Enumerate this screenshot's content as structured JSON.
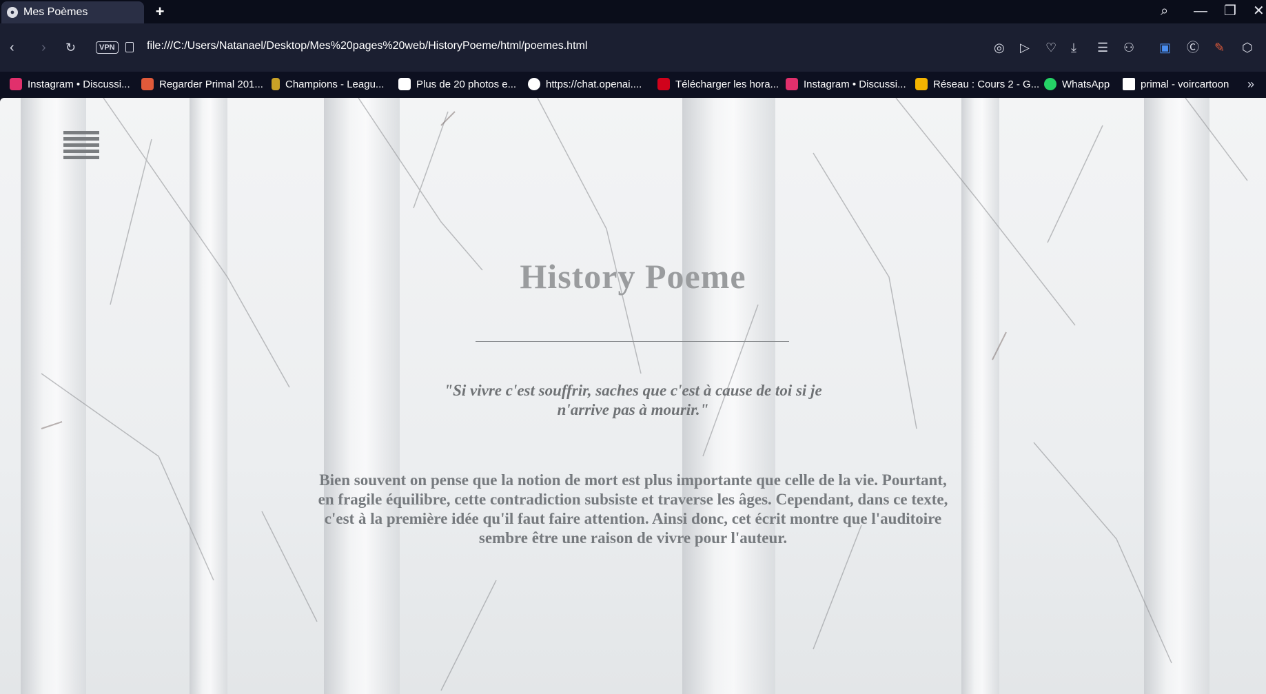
{
  "browser": {
    "tab": {
      "title": "Mes Poèmes"
    },
    "address": {
      "vpn_label": "VPN",
      "url": "file:///C:/Users/Natanael/Desktop/Mes%20pages%20web/HistoryPoeme/html/poemes.html"
    },
    "bookmarks": [
      {
        "label": "Instagram • Discussi...",
        "icon": "instagram-icon",
        "color": "#e1306c"
      },
      {
        "label": "Regarder Primal 201...",
        "icon": "stack-icon",
        "color": "#e05a3a"
      },
      {
        "label": "Champions - Leagu...",
        "icon": "league-icon",
        "color": "#c9a227"
      },
      {
        "label": "Plus de 20 photos e...",
        "icon": "photos-icon",
        "color": "#ffffff"
      },
      {
        "label": "https://chat.openai....",
        "icon": "openai-icon",
        "color": "#ffffff"
      },
      {
        "label": "Télécharger les hora...",
        "icon": "transit-icon",
        "color": "#d0021b"
      },
      {
        "label": "Instagram • Discussi...",
        "icon": "instagram-icon",
        "color": "#e1306c"
      },
      {
        "label": "Réseau : Cours 2 - G...",
        "icon": "slides-icon",
        "color": "#f4b400"
      },
      {
        "label": "WhatsApp",
        "icon": "whatsapp-icon",
        "color": "#25d366"
      },
      {
        "label": "primal - voircartoon",
        "icon": "page-icon",
        "color": "#ffffff"
      }
    ]
  },
  "page": {
    "title": "History Poeme",
    "quote": "\"Si vivre c'est souffrir, saches que c'est à cause de toi si je n'arrive pas à mourir.\"",
    "intro": "Bien souvent on pense que la notion de mort est plus importante que celle de la vie. Pourtant, en fragile équilibre, cette contradiction subsiste et traverse les âges. Cependant, dans ce texte, c'est à la première idée qu'il faut faire attention. Ainsi donc, cet écrit montre que l'auditoire sembre être une raison de vivre pour l'auteur."
  }
}
